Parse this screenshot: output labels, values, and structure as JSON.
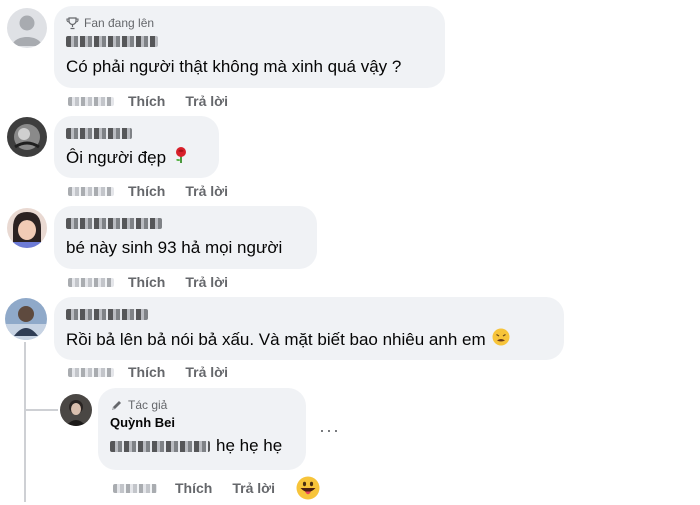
{
  "comments": [
    {
      "badge": "Fan đang lên",
      "text": "Có phải người thật không mà xinh quá vậy ?",
      "like": "Thích",
      "reply": "Trả lời"
    },
    {
      "text": "Ôi người đẹp",
      "emoji": "rose-emoji",
      "like": "Thích",
      "reply": "Trả lời"
    },
    {
      "text": "bé này sinh 93 hả mọi người",
      "like": "Thích",
      "reply": "Trả lời"
    },
    {
      "text": "Rồi bả lên bả nói bả xấu. Và mặt biết bao nhiêu anh em",
      "emoji": "weary-face-emoji",
      "like": "Thích",
      "reply": "Trả lời"
    }
  ],
  "reply": {
    "badge": "Tác giả",
    "name": "Quỳnh Bei",
    "text": "hẹ hẹ hẹ",
    "like": "Thích",
    "reply": "Trả lời",
    "more": "···",
    "reaction": "grinning-tongue-emoji"
  },
  "colors": {
    "bubble": "#f0f2f5",
    "secondary_text": "#65676b",
    "thread_line": "#ced0d4"
  }
}
